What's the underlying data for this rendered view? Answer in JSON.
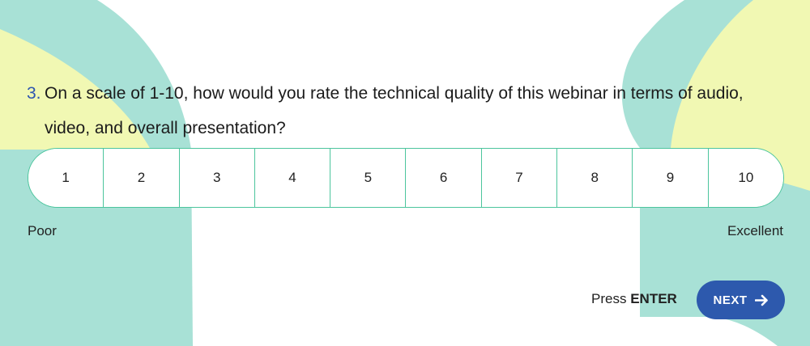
{
  "colors": {
    "accent_number": "#2e56b0",
    "scale_border": "#4cc59d",
    "button_bg": "#2d59ad",
    "blob_teal": "#a8e1d6",
    "blob_yellow": "#f1f8b3"
  },
  "question": {
    "number": "3.",
    "text": "On a scale of 1-10, how would you rate the technical quality of this webinar in terms of audio, video, and overall presentation?"
  },
  "scale": {
    "options": [
      "1",
      "2",
      "3",
      "4",
      "5",
      "6",
      "7",
      "8",
      "9",
      "10"
    ],
    "min_label": "Poor",
    "max_label": "Excellent"
  },
  "footer": {
    "hint_prefix": "Press",
    "hint_key": "ENTER",
    "next_label": "NEXT",
    "next_icon": "arrow-right-icon"
  }
}
